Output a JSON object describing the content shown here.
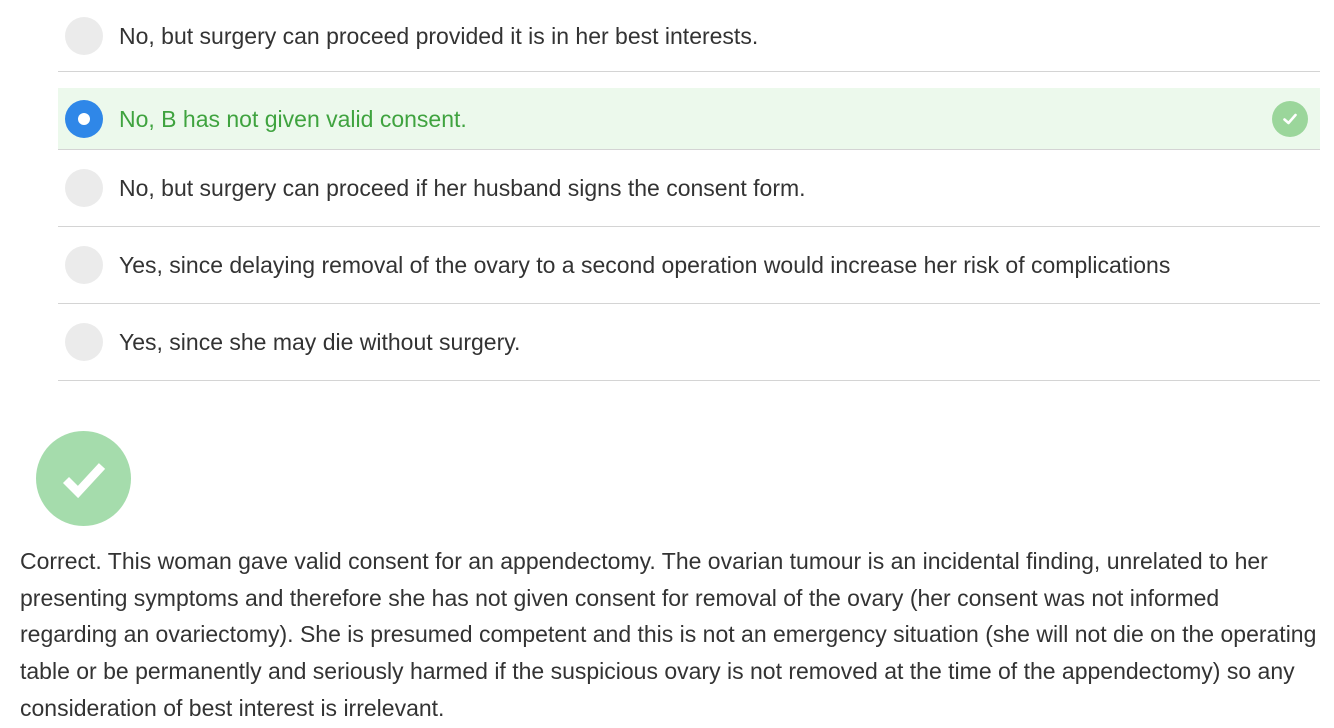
{
  "options": [
    {
      "label": "No, but surgery can proceed provided it is in her best interests.",
      "selected": false
    },
    {
      "label": "No, B has not given valid consent.",
      "selected": true
    },
    {
      "label": "No, but surgery can proceed if her husband signs the consent form.",
      "selected": false
    },
    {
      "label": "Yes, since delaying removal of the ovary to a second operation would increase her risk of complications",
      "selected": false
    },
    {
      "label": "Yes, since she may die without surgery.",
      "selected": false
    }
  ],
  "feedback": {
    "status_icon": "check-circle-icon",
    "explanation": "Correct. This woman gave valid consent for an appendectomy. The ovarian tumour is an incidental finding, unrelated to her presenting symptoms and therefore she has not given consent for removal of the ovary (her consent was not informed regarding an ovariectomy). She is presumed competent and this is not an emergency situation (she will not die on the operating table or be permanently and seriously harmed if the suspicious ovary is not removed at the time of the appendectomy) so any consideration of best interest is irrelevant."
  },
  "colors": {
    "correct_text": "#3fa33f",
    "selected_background": "#ecf9ec",
    "radio_checked": "#2f87e8",
    "check_green": "#a5dcac"
  }
}
